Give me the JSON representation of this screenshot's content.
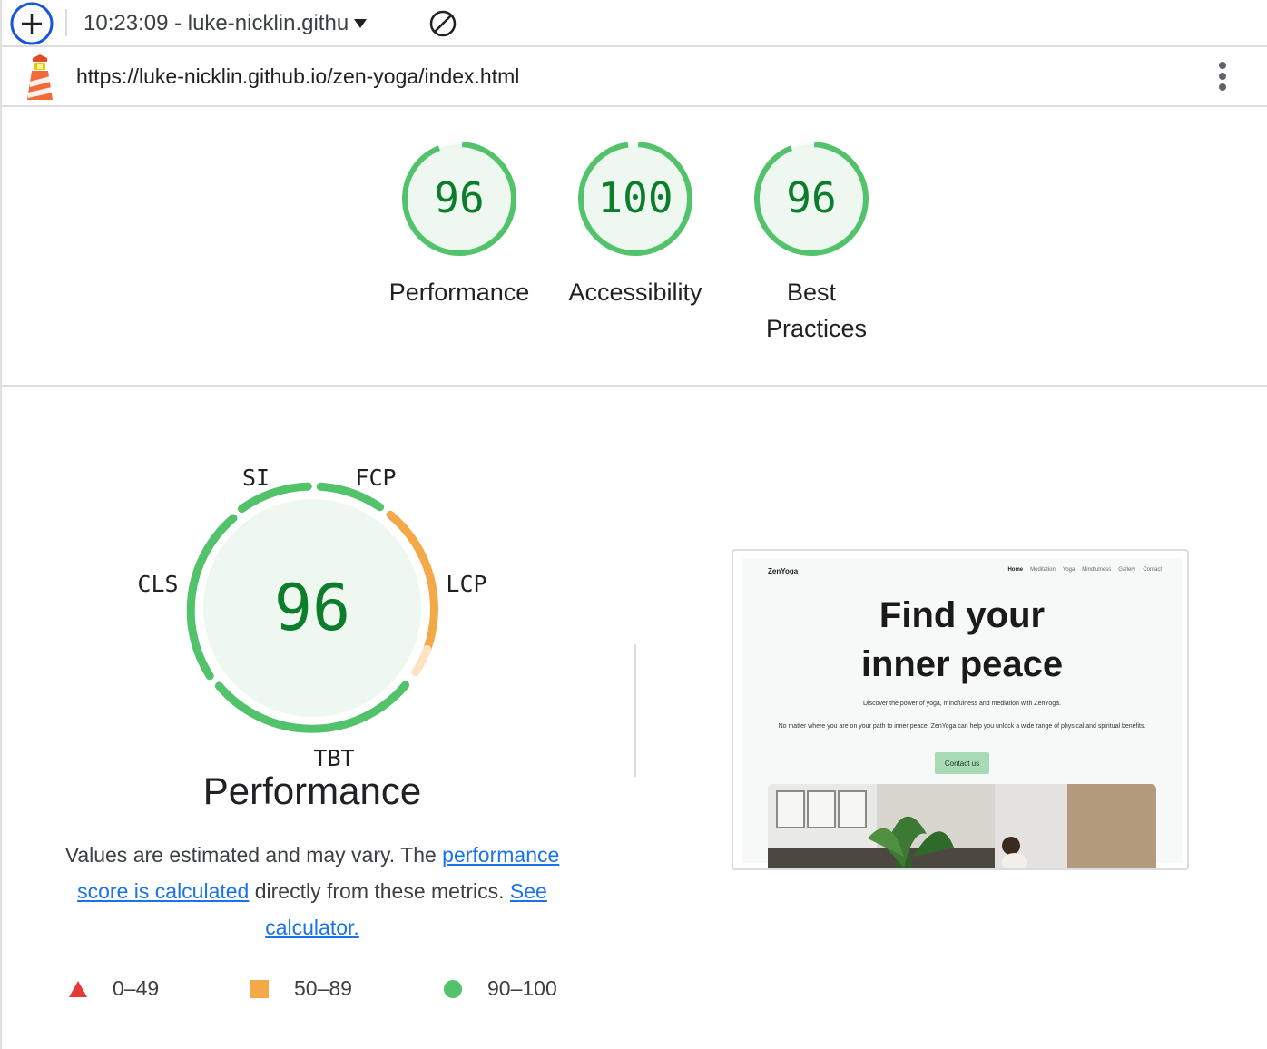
{
  "toolbar": {
    "add_icon": "plus-circle-icon",
    "report_label": "10:23:09 - luke-nicklin.githu",
    "caret_icon": "caret-down-icon",
    "clear_icon": "block-icon"
  },
  "urlbar": {
    "logo_icon": "lighthouse-logo-icon",
    "url": "https://luke-nicklin.github.io/zen-yoga/index.html",
    "menu_icon": "kebab-menu-icon"
  },
  "categories": [
    {
      "score": "96",
      "label": "Performance",
      "fraction": 0.96
    },
    {
      "score": "100",
      "label": "Accessibility",
      "fraction": 1.0
    },
    {
      "score": "96",
      "label": "Best Practices",
      "fraction": 0.96
    }
  ],
  "performance": {
    "score": "96",
    "title": "Performance",
    "metrics": {
      "si": "SI",
      "fcp": "FCP",
      "lcp": "LCP",
      "tbt": "TBT",
      "cls": "CLS"
    },
    "description": {
      "text1": "Values are estimated and may vary. The ",
      "link1": "performance score is calculated",
      "text2": " directly from these metrics. ",
      "link2": "See calculator."
    }
  },
  "legend": [
    {
      "icon": "fail-triangle-icon",
      "range": "0–49"
    },
    {
      "icon": "average-square-icon",
      "range": "50–89"
    },
    {
      "icon": "pass-circle-icon",
      "range": "90–100"
    }
  ],
  "thumbnail": {
    "brand": "ZenYoga",
    "nav": [
      "Home",
      "Meditation",
      "Yoga",
      "Mindfulness",
      "Gallery",
      "Contact"
    ],
    "headline_line1": "Find your",
    "headline_line2": "inner peace",
    "subtitle": "Discover the power of yoga, mindfulness and mediation with ZenYoga.",
    "body": "No matter where you are on your path to inner peace, ZenYoga can help you unlock a wide range of physical and spiritual benefits.",
    "cta": "Contact us"
  },
  "colors": {
    "pass": "#0c7d2a",
    "pass_ring": "#52c36b",
    "pass_fill": "#eef8f0",
    "average": "#f4a949",
    "fail": "#e53935",
    "link": "#1a73e8"
  }
}
